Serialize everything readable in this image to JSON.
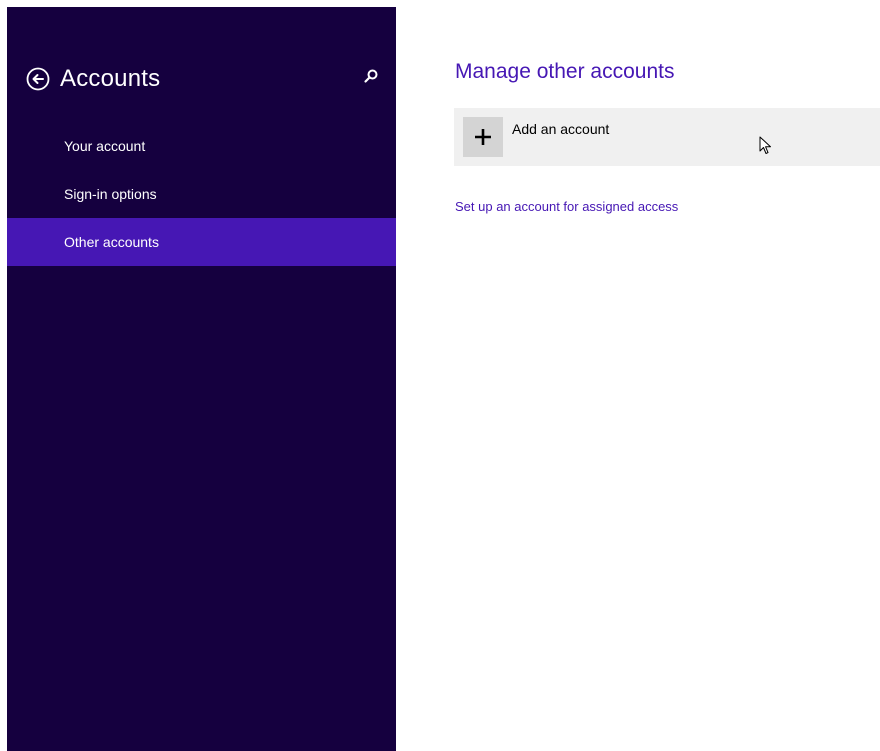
{
  "sidebar": {
    "title": "Accounts",
    "back_icon": "back-arrow-icon",
    "search_icon": "search-icon",
    "items": [
      {
        "label": "Your account",
        "selected": false
      },
      {
        "label": "Sign-in options",
        "selected": false
      },
      {
        "label": "Other accounts",
        "selected": true
      }
    ]
  },
  "main": {
    "title": "Manage other accounts",
    "add_account": {
      "label": "Add an account",
      "icon": "plus-icon"
    },
    "assigned_access_link": "Set up an account for assigned access"
  },
  "colors": {
    "sidebar_background": "#15003f",
    "selected_item": "#4617b4",
    "accent": "#4617b4",
    "tile_background": "#f0f0f0",
    "icon_box": "#d4d4d4"
  }
}
